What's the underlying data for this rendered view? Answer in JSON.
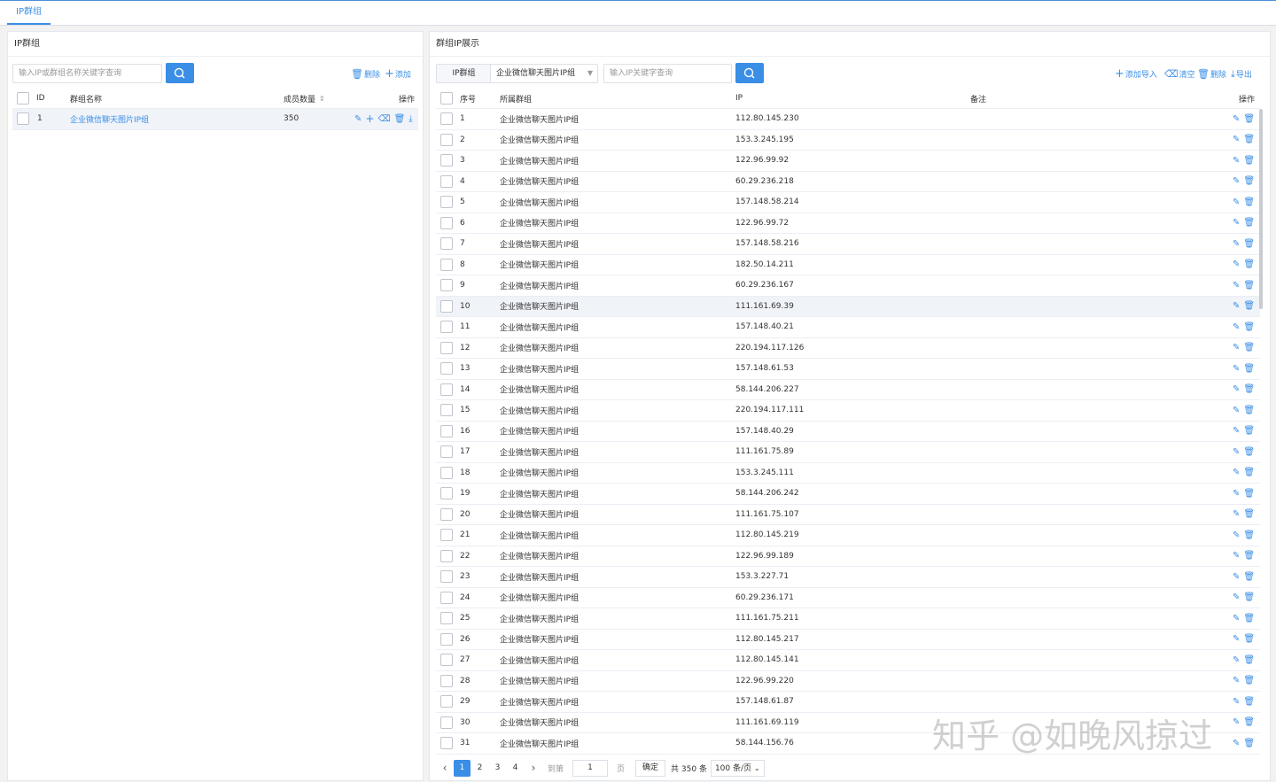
{
  "top_tab": "IP群组",
  "left": {
    "title": "IP群组",
    "search_placeholder": "输入IP或群组名称关键字查询",
    "delete_label": "删除",
    "add_label": "添加",
    "columns": {
      "id": "ID",
      "name": "群组名称",
      "count": "成员数量",
      "ops": "操作"
    },
    "rows": [
      {
        "id": "1",
        "name": "企业微信聊天图片IP组",
        "count": "350"
      }
    ]
  },
  "right": {
    "title": "群组IP展示",
    "group_label": "IP群组",
    "group_selected": "企业微信聊天图片IP组",
    "search_placeholder": "输入IP关键字查询",
    "tools": {
      "import": "添加导入",
      "clear": "清空",
      "delete": "删除",
      "export": "导出"
    },
    "columns": {
      "seq": "序号",
      "group": "所属群组",
      "ip": "IP",
      "note": "备注",
      "ops": "操作"
    },
    "rows": [
      {
        "seq": "1",
        "group": "企业微信聊天图片IP组",
        "ip": "112.80.145.230"
      },
      {
        "seq": "2",
        "group": "企业微信聊天图片IP组",
        "ip": "153.3.245.195"
      },
      {
        "seq": "3",
        "group": "企业微信聊天图片IP组",
        "ip": "122.96.99.92"
      },
      {
        "seq": "4",
        "group": "企业微信聊天图片IP组",
        "ip": "60.29.236.218"
      },
      {
        "seq": "5",
        "group": "企业微信聊天图片IP组",
        "ip": "157.148.58.214"
      },
      {
        "seq": "6",
        "group": "企业微信聊天图片IP组",
        "ip": "122.96.99.72"
      },
      {
        "seq": "7",
        "group": "企业微信聊天图片IP组",
        "ip": "157.148.58.216"
      },
      {
        "seq": "8",
        "group": "企业微信聊天图片IP组",
        "ip": "182.50.14.211"
      },
      {
        "seq": "9",
        "group": "企业微信聊天图片IP组",
        "ip": "60.29.236.167"
      },
      {
        "seq": "10",
        "group": "企业微信聊天图片IP组",
        "ip": "111.161.69.39"
      },
      {
        "seq": "11",
        "group": "企业微信聊天图片IP组",
        "ip": "157.148.40.21"
      },
      {
        "seq": "12",
        "group": "企业微信聊天图片IP组",
        "ip": "220.194.117.126"
      },
      {
        "seq": "13",
        "group": "企业微信聊天图片IP组",
        "ip": "157.148.61.53"
      },
      {
        "seq": "14",
        "group": "企业微信聊天图片IP组",
        "ip": "58.144.206.227"
      },
      {
        "seq": "15",
        "group": "企业微信聊天图片IP组",
        "ip": "220.194.117.111"
      },
      {
        "seq": "16",
        "group": "企业微信聊天图片IP组",
        "ip": "157.148.40.29"
      },
      {
        "seq": "17",
        "group": "企业微信聊天图片IP组",
        "ip": "111.161.75.89"
      },
      {
        "seq": "18",
        "group": "企业微信聊天图片IP组",
        "ip": "153.3.245.111"
      },
      {
        "seq": "19",
        "group": "企业微信聊天图片IP组",
        "ip": "58.144.206.242"
      },
      {
        "seq": "20",
        "group": "企业微信聊天图片IP组",
        "ip": "111.161.75.107"
      },
      {
        "seq": "21",
        "group": "企业微信聊天图片IP组",
        "ip": "112.80.145.219"
      },
      {
        "seq": "22",
        "group": "企业微信聊天图片IP组",
        "ip": "122.96.99.189"
      },
      {
        "seq": "23",
        "group": "企业微信聊天图片IP组",
        "ip": "153.3.227.71"
      },
      {
        "seq": "24",
        "group": "企业微信聊天图片IP组",
        "ip": "60.29.236.171"
      },
      {
        "seq": "25",
        "group": "企业微信聊天图片IP组",
        "ip": "111.161.75.211"
      },
      {
        "seq": "26",
        "group": "企业微信聊天图片IP组",
        "ip": "112.80.145.217"
      },
      {
        "seq": "27",
        "group": "企业微信聊天图片IP组",
        "ip": "112.80.145.141"
      },
      {
        "seq": "28",
        "group": "企业微信聊天图片IP组",
        "ip": "122.96.99.220"
      },
      {
        "seq": "29",
        "group": "企业微信聊天图片IP组",
        "ip": "157.148.61.87"
      },
      {
        "seq": "30",
        "group": "企业微信聊天图片IP组",
        "ip": "111.161.69.119"
      },
      {
        "seq": "31",
        "group": "企业微信聊天图片IP组",
        "ip": "58.144.156.76"
      }
    ],
    "highlight_row": "10",
    "pager": {
      "pages": [
        "1",
        "2",
        "3",
        "4"
      ],
      "current": "1",
      "goto_label": "到第",
      "goto_value": "1",
      "page_unit": "页",
      "confirm": "确定",
      "total": "共 350 条",
      "page_size": "100 条/页"
    }
  },
  "watermark": "知乎 @如晚风掠过",
  "colors": {
    "accent": "#3a8ee6",
    "border": "#ebeef5",
    "row_highlight": "#f0f3f8"
  },
  "icons": {
    "search": "search-icon",
    "edit": "pencil-icon",
    "delete": "trash-icon",
    "add": "plus-icon",
    "clear": "eraser-icon",
    "export": "download-icon"
  }
}
